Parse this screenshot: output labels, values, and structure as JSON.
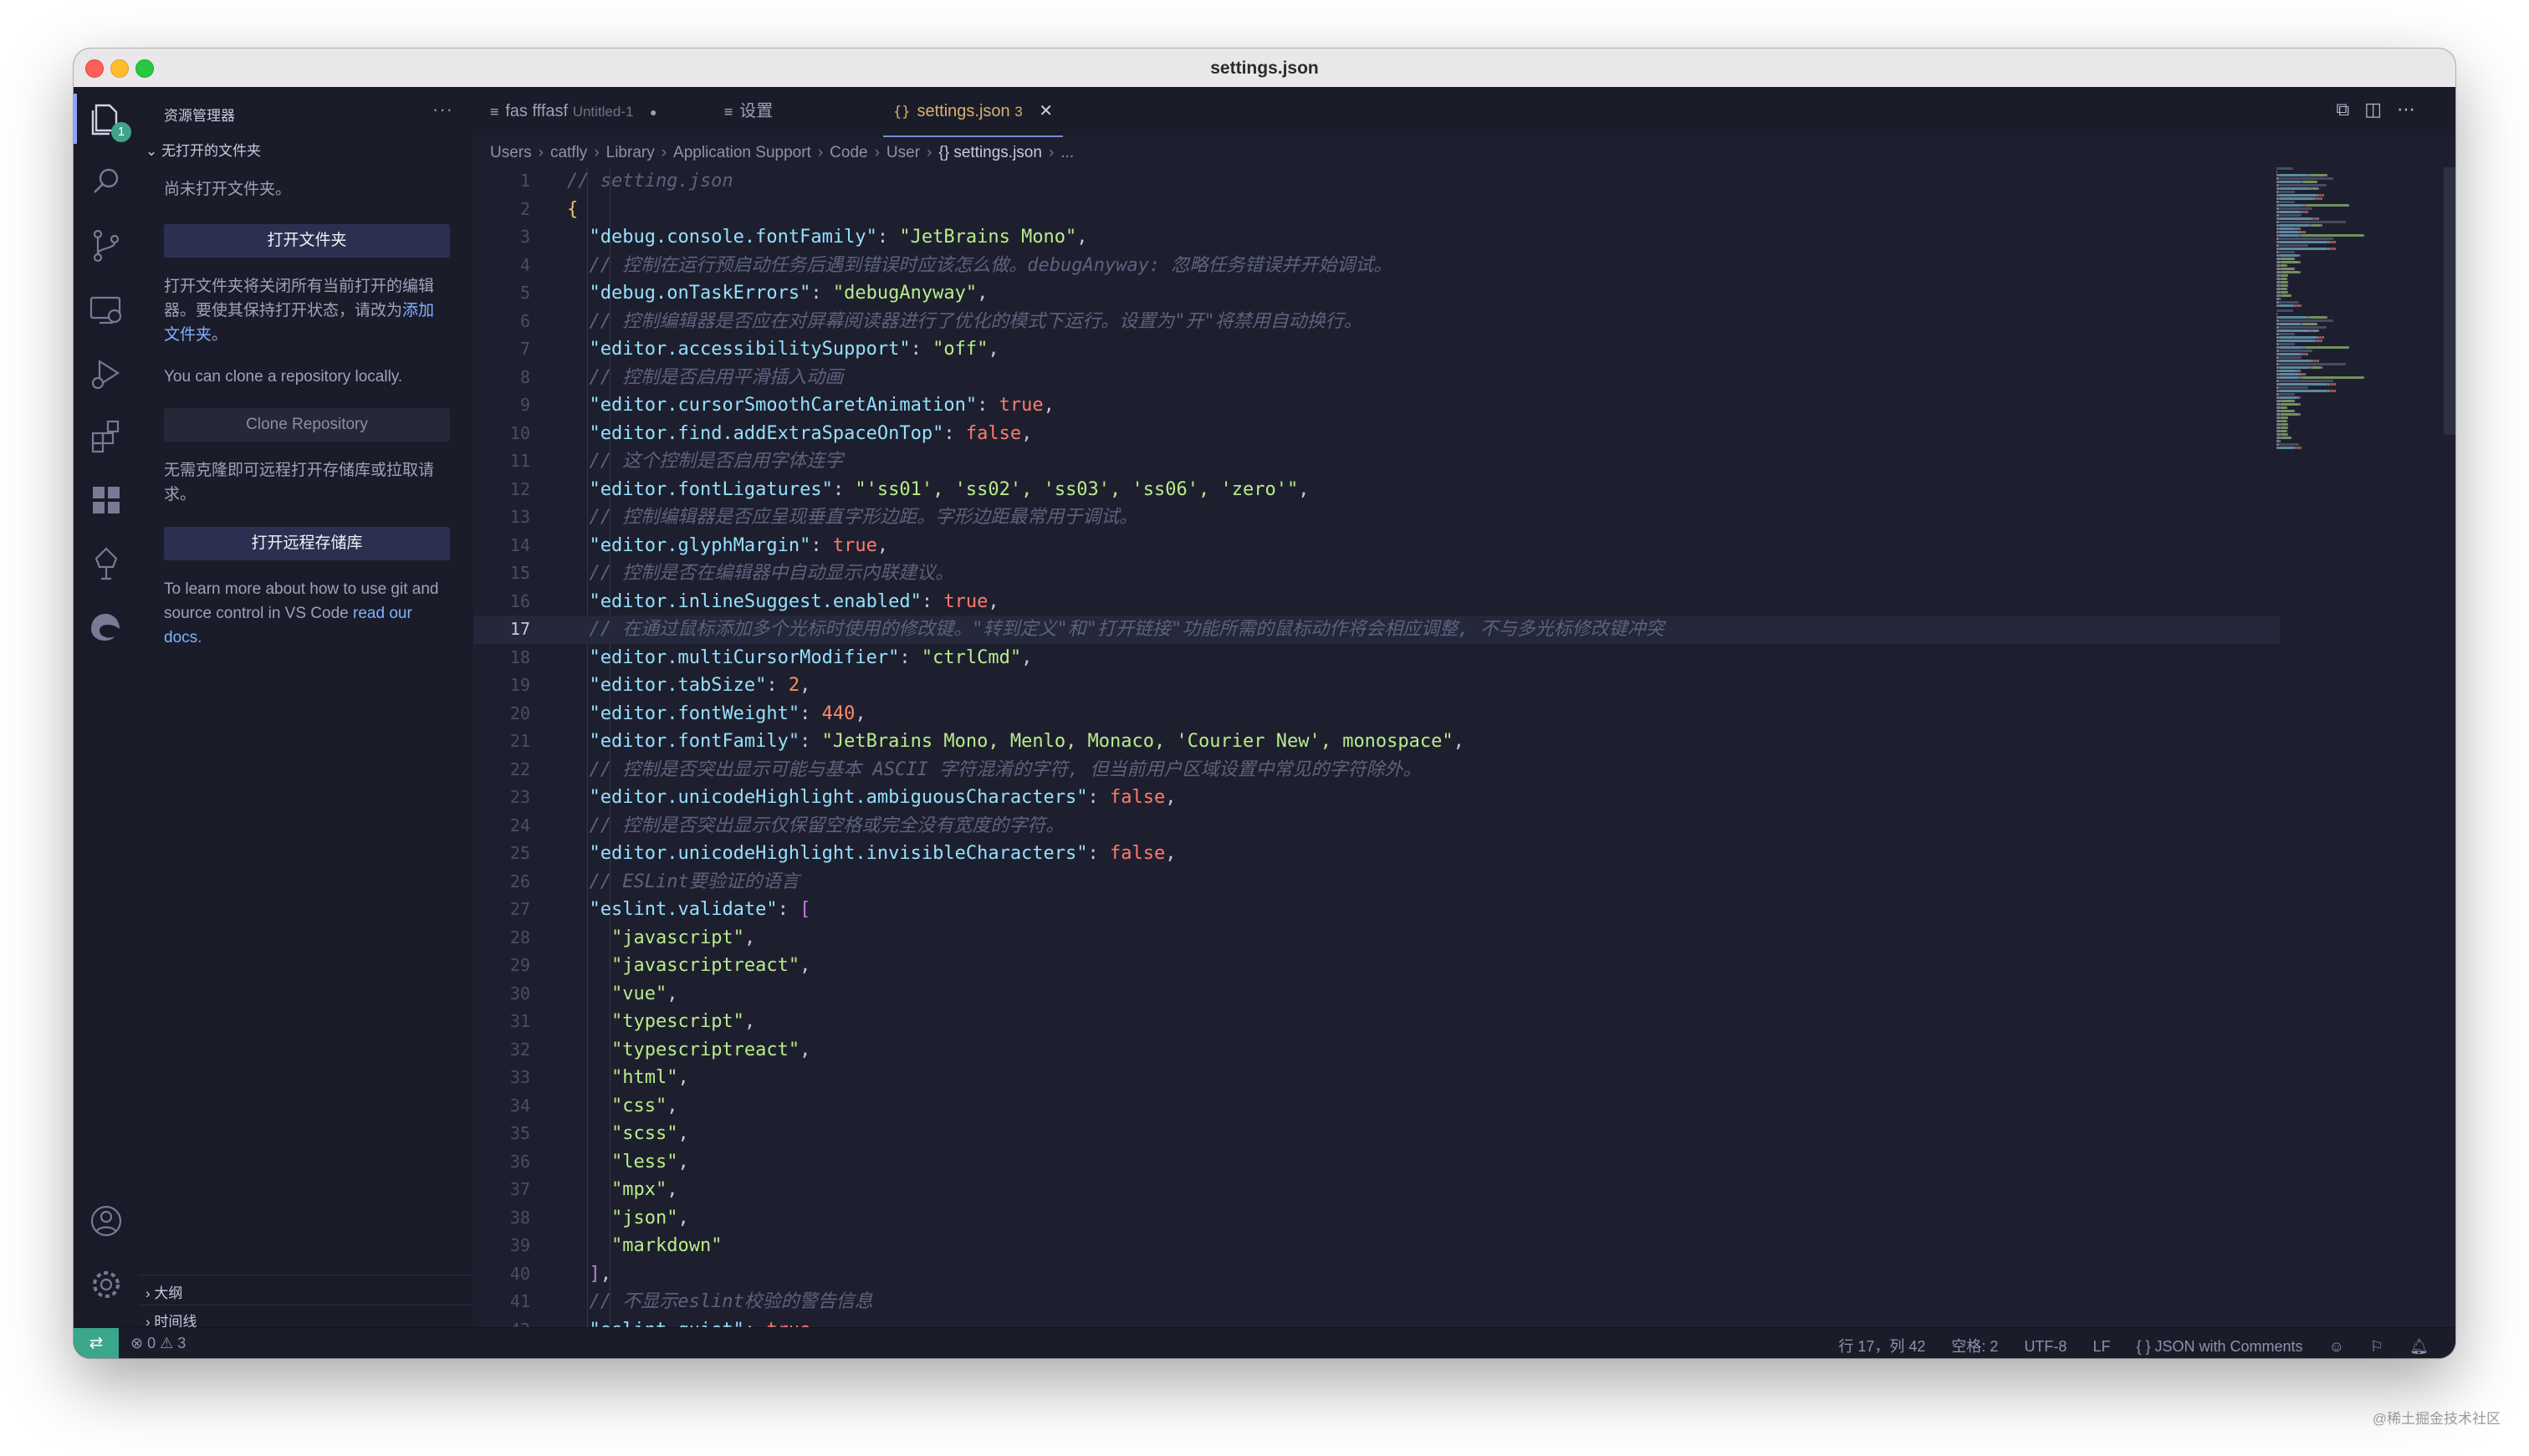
{
  "window": {
    "title": "settings.json"
  },
  "activity_bar": {
    "explorer_badge": "1",
    "icons": [
      "files-icon",
      "search-icon",
      "source-control-icon",
      "remote-explorer-icon",
      "run-debug-icon",
      "extensions-icon",
      "grid-icon",
      "tree-icon",
      "edge-icon",
      "account-icon",
      "settings-gear-icon"
    ]
  },
  "sidebar": {
    "title": "资源管理器",
    "more": "···",
    "section": "无打开的文件夹",
    "no_folder": "尚未打开文件夹。",
    "open_folder_btn": "打开文件夹",
    "open_folder_hint_1": "打开文件夹将关闭所有当前打开的编辑器。要使其保持打开状态，请改为",
    "open_folder_hint_link": "添加文件夹",
    "open_folder_hint_2": "。",
    "clone_hint": "You can clone a repository locally.",
    "clone_btn": "Clone Repository",
    "remote_hint": "无需克隆即可远程打开存储库或拉取请求。",
    "open_remote_btn": "打开远程存储库",
    "learn_1": "To learn more about how to use git and source control in VS Code ",
    "learn_link": "read our docs",
    "learn_2": ".",
    "outline": "大纲",
    "timeline": "时间线"
  },
  "tabs": [
    {
      "label": "fas fffasf",
      "desc": "Untitled-1",
      "icon": "≡",
      "marker": "●"
    },
    {
      "label": "设置",
      "icon": "≡"
    },
    {
      "label": "settings.json",
      "count": "3",
      "icon": "{}",
      "close": "✕"
    }
  ],
  "breadcrumb": [
    "Users",
    "catfly",
    "Library",
    "Application Support",
    "Code",
    "User",
    "{} settings.json",
    "..."
  ],
  "code": {
    "current_line": 17,
    "lines": [
      [
        [
          "c",
          "// setting.json"
        ]
      ],
      [
        [
          "br",
          "{"
        ]
      ],
      [
        [
          "p",
          "  "
        ],
        [
          "k",
          "\"debug.console.fontFamily\""
        ],
        [
          "p",
          ": "
        ],
        [
          "s",
          "\"JetBrains Mono\""
        ],
        [
          "p",
          ","
        ]
      ],
      [
        [
          "p",
          "  "
        ],
        [
          "c",
          "// 控制在运行预启动任务后遇到错误时应该怎么做。debugAnyway: 忽略任务错误并开始调试。"
        ]
      ],
      [
        [
          "p",
          "  "
        ],
        [
          "k",
          "\"debug.onTaskErrors\""
        ],
        [
          "p",
          ": "
        ],
        [
          "s",
          "\"debugAnyway\""
        ],
        [
          "p",
          ","
        ]
      ],
      [
        [
          "p",
          "  "
        ],
        [
          "c",
          "// 控制编辑器是否应在对屏幕阅读器进行了优化的模式下运行。设置为\"开\"将禁用自动换行。"
        ]
      ],
      [
        [
          "p",
          "  "
        ],
        [
          "k",
          "\"editor.accessibilitySupport\""
        ],
        [
          "p",
          ": "
        ],
        [
          "s",
          "\"off\""
        ],
        [
          "p",
          ","
        ]
      ],
      [
        [
          "p",
          "  "
        ],
        [
          "c",
          "// 控制是否启用平滑插入动画"
        ]
      ],
      [
        [
          "p",
          "  "
        ],
        [
          "k",
          "\"editor.cursorSmoothCaretAnimation\""
        ],
        [
          "p",
          ": "
        ],
        [
          "b",
          "true"
        ],
        [
          "p",
          ","
        ]
      ],
      [
        [
          "p",
          "  "
        ],
        [
          "k",
          "\"editor.find.addExtraSpaceOnTop\""
        ],
        [
          "p",
          ": "
        ],
        [
          "b",
          "false"
        ],
        [
          "p",
          ","
        ]
      ],
      [
        [
          "p",
          "  "
        ],
        [
          "c",
          "// 这个控制是否启用字体连字"
        ]
      ],
      [
        [
          "p",
          "  "
        ],
        [
          "k",
          "\"editor.fontLigatures\""
        ],
        [
          "p",
          ": "
        ],
        [
          "s",
          "\"'ss01', 'ss02', 'ss03', 'ss06', 'zero'\""
        ],
        [
          "p",
          ","
        ]
      ],
      [
        [
          "p",
          "  "
        ],
        [
          "c",
          "// 控制编辑器是否应呈现垂直字形边距。字形边距最常用于调试。"
        ]
      ],
      [
        [
          "p",
          "  "
        ],
        [
          "k",
          "\"editor.glyphMargin\""
        ],
        [
          "p",
          ": "
        ],
        [
          "b",
          "true"
        ],
        [
          "p",
          ","
        ]
      ],
      [
        [
          "p",
          "  "
        ],
        [
          "c",
          "// 控制是否在编辑器中自动显示内联建议。"
        ]
      ],
      [
        [
          "p",
          "  "
        ],
        [
          "k",
          "\"editor.inlineSuggest.enabled\""
        ],
        [
          "p",
          ": "
        ],
        [
          "b",
          "true"
        ],
        [
          "p",
          ","
        ]
      ],
      [
        [
          "p",
          "  "
        ],
        [
          "c",
          "// 在通过鼠标添加多个光标时使用的修改键。\"转到定义\"和\"打开链接\"功能所需的鼠标动作将会相应调整, 不与多光标修改键冲突"
        ]
      ],
      [
        [
          "p",
          "  "
        ],
        [
          "k",
          "\"editor.multiCursorModifier\""
        ],
        [
          "p",
          ": "
        ],
        [
          "s",
          "\"ctrlCmd\""
        ],
        [
          "p",
          ","
        ]
      ],
      [
        [
          "p",
          "  "
        ],
        [
          "k",
          "\"editor.tabSize\""
        ],
        [
          "p",
          ": "
        ],
        [
          "n",
          "2"
        ],
        [
          "p",
          ","
        ]
      ],
      [
        [
          "p",
          "  "
        ],
        [
          "k",
          "\"editor.fontWeight\""
        ],
        [
          "p",
          ": "
        ],
        [
          "n",
          "440"
        ],
        [
          "p",
          ","
        ]
      ],
      [
        [
          "p",
          "  "
        ],
        [
          "k",
          "\"editor.fontFamily\""
        ],
        [
          "p",
          ": "
        ],
        [
          "s",
          "\"JetBrains Mono, Menlo, Monaco, 'Courier New', monospace\""
        ],
        [
          "p",
          ","
        ]
      ],
      [
        [
          "p",
          "  "
        ],
        [
          "c",
          "// 控制是否突出显示可能与基本 ASCII 字符混淆的字符, 但当前用户区域设置中常见的字符除外。"
        ]
      ],
      [
        [
          "p",
          "  "
        ],
        [
          "k",
          "\"editor.unicodeHighlight.ambiguousCharacters\""
        ],
        [
          "p",
          ": "
        ],
        [
          "b",
          "false"
        ],
        [
          "p",
          ","
        ]
      ],
      [
        [
          "p",
          "  "
        ],
        [
          "c",
          "// 控制是否突出显示仅保留空格或完全没有宽度的字符。"
        ]
      ],
      [
        [
          "p",
          "  "
        ],
        [
          "k",
          "\"editor.unicodeHighlight.invisibleCharacters\""
        ],
        [
          "p",
          ": "
        ],
        [
          "b",
          "false"
        ],
        [
          "p",
          ","
        ]
      ],
      [
        [
          "p",
          "  "
        ],
        [
          "c",
          "// ESLint要验证的语言"
        ]
      ],
      [
        [
          "p",
          "  "
        ],
        [
          "k",
          "\"eslint.validate\""
        ],
        [
          "p",
          ": "
        ],
        [
          "bk",
          "["
        ]
      ],
      [
        [
          "p",
          "    "
        ],
        [
          "s",
          "\"javascript\""
        ],
        [
          "p",
          ","
        ]
      ],
      [
        [
          "p",
          "    "
        ],
        [
          "s",
          "\"javascriptreact\""
        ],
        [
          "p",
          ","
        ]
      ],
      [
        [
          "p",
          "    "
        ],
        [
          "s",
          "\"vue\""
        ],
        [
          "p",
          ","
        ]
      ],
      [
        [
          "p",
          "    "
        ],
        [
          "s",
          "\"typescript\""
        ],
        [
          "p",
          ","
        ]
      ],
      [
        [
          "p",
          "    "
        ],
        [
          "s",
          "\"typescriptreact\""
        ],
        [
          "p",
          ","
        ]
      ],
      [
        [
          "p",
          "    "
        ],
        [
          "s",
          "\"html\""
        ],
        [
          "p",
          ","
        ]
      ],
      [
        [
          "p",
          "    "
        ],
        [
          "s",
          "\"css\""
        ],
        [
          "p",
          ","
        ]
      ],
      [
        [
          "p",
          "    "
        ],
        [
          "s",
          "\"scss\""
        ],
        [
          "p",
          ","
        ]
      ],
      [
        [
          "p",
          "    "
        ],
        [
          "s",
          "\"less\""
        ],
        [
          "p",
          ","
        ]
      ],
      [
        [
          "p",
          "    "
        ],
        [
          "s",
          "\"mpx\""
        ],
        [
          "p",
          ","
        ]
      ],
      [
        [
          "p",
          "    "
        ],
        [
          "s",
          "\"json\""
        ],
        [
          "p",
          ","
        ]
      ],
      [
        [
          "p",
          "    "
        ],
        [
          "s",
          "\"markdown\""
        ]
      ],
      [
        [
          "p",
          "  "
        ],
        [
          "bk",
          "]"
        ],
        [
          "p",
          ","
        ]
      ],
      [
        [
          "p",
          "  "
        ],
        [
          "c",
          "// 不显示eslint校验的警告信息"
        ]
      ],
      [
        [
          "p",
          "  "
        ],
        [
          "k",
          "\"eslint.quiet\""
        ],
        [
          "p",
          ": "
        ],
        [
          "b",
          "true"
        ],
        [
          "p",
          ","
        ]
      ]
    ]
  },
  "status": {
    "remote_icon": "⇄",
    "errors": "⊗ 0",
    "warnings": "⚠ 3",
    "position": "行 17，列 42",
    "spaces": "空格: 2",
    "encoding": "UTF-8",
    "eol": "LF",
    "language": "{ } JSON with Comments"
  },
  "watermark": "@稀土掘金技术社区"
}
